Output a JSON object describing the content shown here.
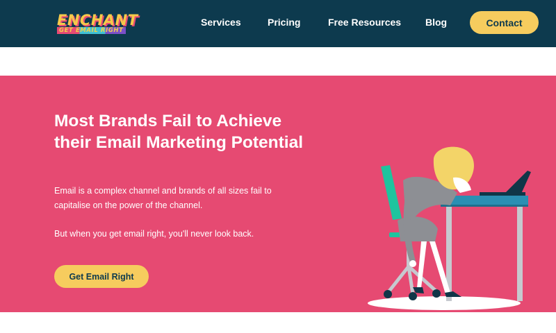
{
  "header": {
    "logo": {
      "main_text": "ENCHANT",
      "tagline": "GET EMAIL RIGHT"
    },
    "nav": {
      "services": "Services",
      "pricing": "Pricing",
      "free_resources": "Free Resources",
      "blog": "Blog"
    },
    "contact_label": "Contact"
  },
  "hero": {
    "title": "Most Brands Fail to Achieve their Email Marketing Potential",
    "paragraph_1": "Email is a complex channel and brands of all sizes fail to capitalise on the power of the channel.",
    "paragraph_2": "But when you get email right, you'll never look back.",
    "cta_label": "Get Email Right"
  },
  "colors": {
    "navbar": "#0d3a4e",
    "hero_background": "#e64a72",
    "button": "#f6cc5e",
    "button_text": "#0d3a4e"
  },
  "illustration": {
    "icon": "frustrated-person-at-desk-illustration"
  }
}
